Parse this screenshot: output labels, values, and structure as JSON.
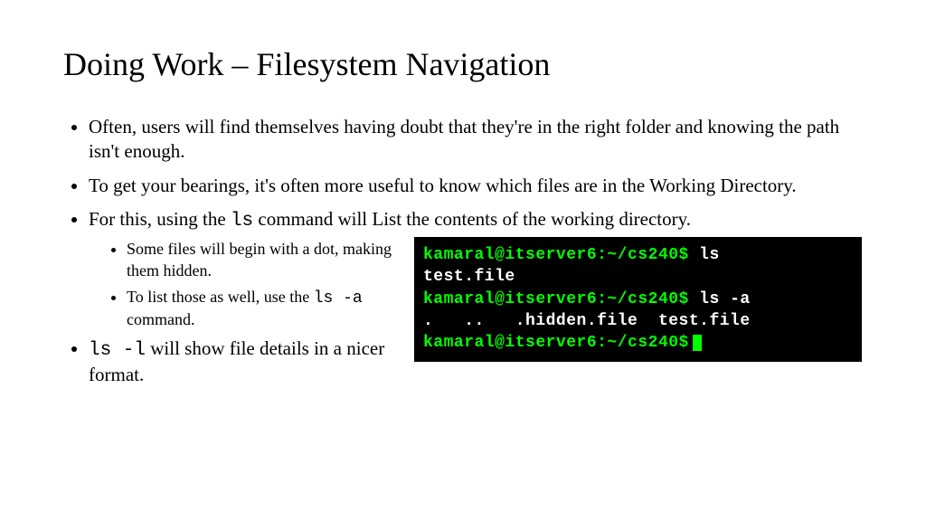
{
  "title": "Doing Work – Filesystem Navigation",
  "bullets": {
    "b1": "Often, users will find themselves having doubt that they're in the right folder and knowing the path isn't enough.",
    "b2": "To get your bearings, it's often more useful to know which files are in the Working Directory.",
    "b3_pre": "For this, using the ",
    "b3_code": "ls",
    "b3_post": " command will List the contents of the working directory.",
    "sub1": "Some files will begin with a dot, making them hidden.",
    "sub2_pre": "To list those as well, use the ",
    "sub2_code": "ls -a",
    "sub2_post": " command.",
    "b4_code": "ls -l",
    "b4_post": " will show file details in a nicer format."
  },
  "terminal": {
    "prompt1": "kamaral@itserver6:~/cs240$",
    "cmd1": " ls",
    "out1": "test.file",
    "prompt2": "kamaral@itserver6:~/cs240$",
    "cmd2": " ls -a",
    "out2": ".   ..   .hidden.file  test.file",
    "prompt3": "kamaral@itserver6:~/cs240$"
  }
}
